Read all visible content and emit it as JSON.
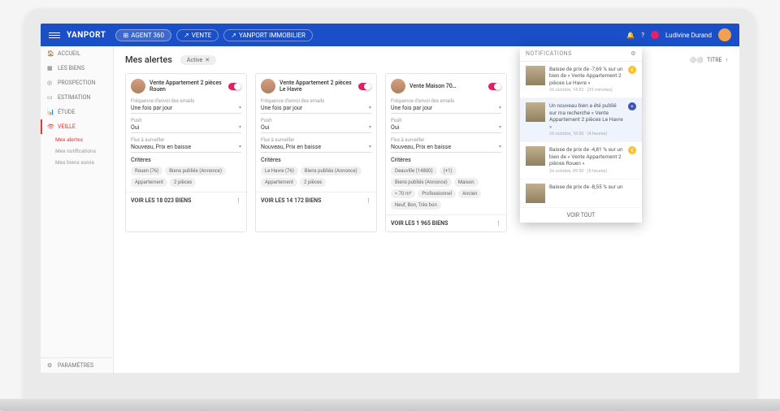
{
  "header": {
    "logo": "YANPORT",
    "nav": [
      {
        "label": "AGENT 360"
      },
      {
        "label": "VENTE"
      },
      {
        "label": "YANPORT IMMOBILIER"
      }
    ],
    "user": "Ludivine Durand"
  },
  "sidebar": {
    "items": [
      {
        "label": "ACCUEIL"
      },
      {
        "label": "LES BIENS"
      },
      {
        "label": "PROSPECTION"
      },
      {
        "label": "ESTIMATION"
      },
      {
        "label": "ÉTUDE"
      },
      {
        "label": "VEILLE"
      }
    ],
    "subs": [
      {
        "label": "Mes alertes"
      },
      {
        "label": "Mes notifications"
      },
      {
        "label": "Mes biens suivis"
      }
    ],
    "bottom": "PARAMÈTRES"
  },
  "page": {
    "title": "Mes alertes",
    "filter": "Active",
    "sort_label": "TITRE"
  },
  "alerts": [
    {
      "title": "Vente Appartement 2 pièces Rouen",
      "freq_label": "Fréquence d'envoi des emails",
      "freq": "Une fois par jour",
      "push_label": "Push",
      "push": "Oui",
      "watch_label": "Flux à surveiller",
      "watch": "Nouveau, Prix en baisse",
      "crit_label": "Critères",
      "tags": [
        "Rouen (76)",
        "Biens publiés (Annonce)",
        "Appartement",
        "2 pièces"
      ],
      "foot": "VOIR LES 18 023 BIENS"
    },
    {
      "title": "Vente Appartement 2 pièces Le Havre",
      "freq_label": "Fréquence d'envoi des emails",
      "freq": "Une fois par jour",
      "push_label": "Push",
      "push": "Oui",
      "watch_label": "Flux à surveiller",
      "watch": "Nouveau, Prix en baisse",
      "crit_label": "Critères",
      "tags": [
        "Le Havre (76)",
        "Biens publiés (Annonce)",
        "Appartement",
        "2 pièces"
      ],
      "foot": "VOIR LES 14 172 BIENS"
    },
    {
      "title": "Vente Maison 70…",
      "freq_label": "Fréquence d'envoi des emails",
      "freq": "Une fois par jour",
      "push_label": "Push",
      "push": "Oui",
      "watch_label": "Flux à surveiller",
      "watch": "Nouveau, Prix en baisse",
      "crit_label": "Critères",
      "tags": [
        "Deauville (14800)",
        "(+1)",
        "Biens publiés (Annonce)",
        "Maison",
        "> 70 m²",
        "Professionnel",
        "Ancien",
        "Neuf, Bon, Très bon"
      ],
      "foot": "VOIR LES 1 965 BIENS"
    }
  ],
  "notifications": {
    "title": "NOTIFICATIONS",
    "items": [
      {
        "text": "Baisse de prix de -7,69 % sur un bien de « Vente Appartement 2 pièces Le Havre »",
        "time": "26 octobre, 14:52 · (33 minutes)",
        "badge": "€"
      },
      {
        "text": "Un nouveau bien a été publié sur ma recherche « Vente Appartement 2 pièces Le Havre »",
        "time": "26 octobre, 10:50 · (4 heures)",
        "badge": "+",
        "blue": true
      },
      {
        "text": "Baisse de prix de -4,81 % sur un bien de « Vente Appartement 2 pièces Rouen »",
        "time": "26 octobre, 09:50 · (5 heures)",
        "badge": "€"
      },
      {
        "text": "Baisse de prix de -8,55 % sur un",
        "time": "",
        "badge": ""
      }
    ],
    "footer": "VOIR TOUT"
  }
}
